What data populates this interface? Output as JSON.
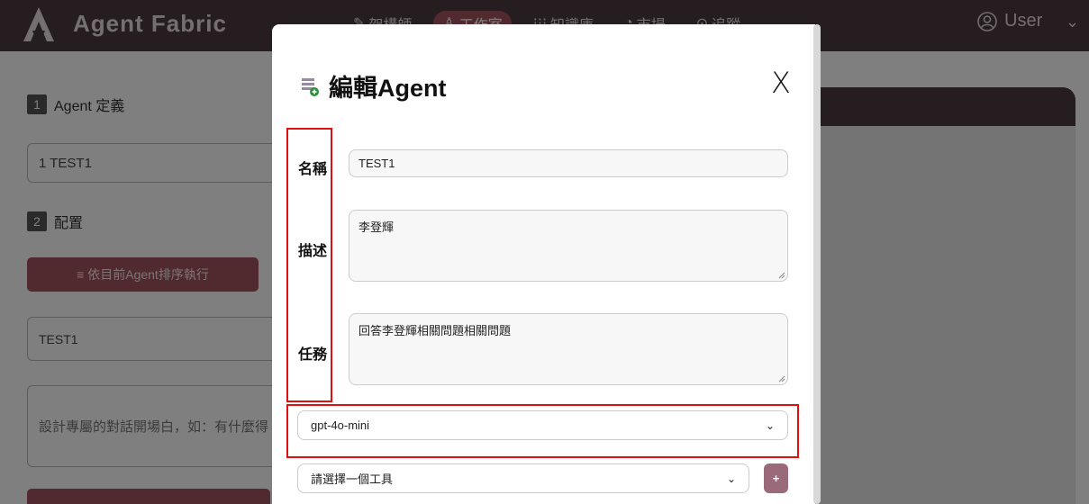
{
  "app": {
    "name": "Agent Fabric"
  },
  "nav": {
    "items": [
      {
        "label": "架構師",
        "icon": "wand-icon"
      },
      {
        "label": "工作室",
        "icon": "studio-icon",
        "active": true
      },
      {
        "label": "知識庫",
        "icon": "grid-icon"
      },
      {
        "label": "市場",
        "icon": "globe-icon"
      },
      {
        "label": "追蹤",
        "icon": "pin-icon"
      }
    ],
    "user_label": "User"
  },
  "background": {
    "step1_num": "1",
    "step1_label": "Agent 定義",
    "agent_list_item": "1  TEST1",
    "step2_num": "2",
    "step2_label": "配置",
    "run_button": "≡ 依目前Agent排序執行",
    "agent_name_value": "TEST1",
    "greeting_placeholder": "設計專屬的對話開場白，如：有什麼得"
  },
  "modal": {
    "title": "編輯Agent",
    "close_label": "X",
    "name_label": "名稱",
    "name_value": "TEST1",
    "desc_label": "描述",
    "desc_value": "李登輝",
    "task_label": "任務",
    "task_value": "回答李登輝相關問題相關問題",
    "model_select": "gpt-4o-mini",
    "tool_select": "請選擇一個工具",
    "add_tool_label": "+"
  },
  "colors": {
    "topbar": "#4a3a40",
    "accent": "#a0555e",
    "highlight": "#e01010"
  }
}
